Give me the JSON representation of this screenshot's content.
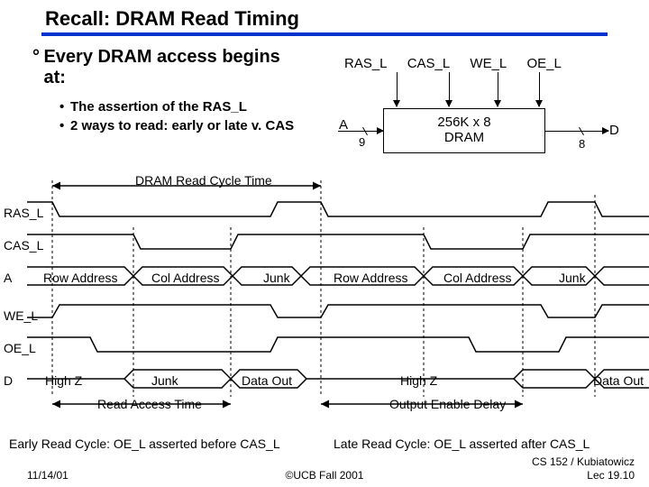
{
  "title": "Recall: DRAM Read Timing",
  "main_bullet_prefix": "°",
  "main_bullet": "Every DRAM access begins at:",
  "sub_bullets": [
    "The assertion of the RAS_L",
    "2 ways to read: early or late v. CAS"
  ],
  "signals": {
    "ras": "RAS_L",
    "cas": "CAS_L",
    "we": "WE_L",
    "oe": "OE_L"
  },
  "dram_box": {
    "line1": "256K x 8",
    "line2": "DRAM"
  },
  "ports": {
    "a": "A",
    "a_bits": "9",
    "d": "D",
    "d_bits": "8"
  },
  "timing_labels": {
    "cycle": "DRAM Read Cycle Time",
    "ras": "RAS_L",
    "cas": "CAS_L",
    "a": "A",
    "we": "WE_L",
    "oe": "OE_L",
    "d": "D",
    "row_addr": "Row Address",
    "col_addr": "Col Address",
    "junk": "Junk",
    "highz": "High Z",
    "data_out": "Data Out",
    "read_access": "Read Access Time",
    "out_enable": "Output Enable Delay",
    "early": "Early Read Cycle: OE_L asserted before CAS_L",
    "late": "Late Read Cycle: OE_L asserted after CAS_L"
  },
  "footer": {
    "date": "11/14/01",
    "center": "©UCB Fall 2001",
    "right1": "CS 152 / Kubiatowicz",
    "right2": "Lec 19.10"
  }
}
